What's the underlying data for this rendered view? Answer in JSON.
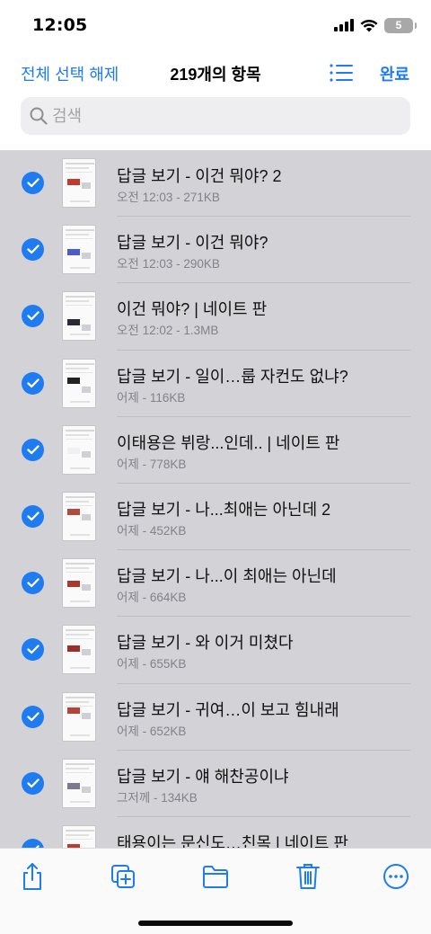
{
  "status": {
    "time": "12:05",
    "battery": "5"
  },
  "nav": {
    "deselect_all": "전체 선택 해제",
    "title": "219개의 항목",
    "done": "완료"
  },
  "search": {
    "placeholder": "검색"
  },
  "items": [
    {
      "title": "답글 보기 - 이건 뭐야? 2",
      "subtitle": "오전 12:03 - 271KB",
      "selected": true,
      "thumb_accent": "#c0392b"
    },
    {
      "title": "답글 보기 - 이건 뭐야?",
      "subtitle": "오전 12:03 - 290KB",
      "selected": true,
      "thumb_accent": "#4a5bd0"
    },
    {
      "title": "이건 뭐야? | 네이트 판",
      "subtitle": "오전 12:02 - 1.3MB",
      "selected": true,
      "thumb_accent": "#2a2a35"
    },
    {
      "title": "답글 보기 - 일이…룹 자컨도 없냐?",
      "subtitle": "어제 - 116KB",
      "selected": true,
      "thumb_accent": "#222222"
    },
    {
      "title": "이태용은 뷔랑...인데.. | 네이트 판",
      "subtitle": "어제 - 778KB",
      "selected": true,
      "thumb_accent": "#f0f0f0"
    },
    {
      "title": "답글 보기 - 나...최애는 아닌데 2",
      "subtitle": "어제 - 452KB",
      "selected": true,
      "thumb_accent": "#b04a3a"
    },
    {
      "title": "답글 보기 - 나...이 최애는 아닌데",
      "subtitle": "어제 - 664KB",
      "selected": true,
      "thumb_accent": "#a83a30"
    },
    {
      "title": "답글 보기 - 와 이거 미쳤다",
      "subtitle": "어제 - 655KB",
      "selected": true,
      "thumb_accent": "#9c2f2a"
    },
    {
      "title": "답글 보기 - 귀여…이 보고 힘내래",
      "subtitle": "어제 - 652KB",
      "selected": true,
      "thumb_accent": "#b5433a"
    },
    {
      "title": "답글 보기 - 얘 해찬공이냐",
      "subtitle": "그저께 - 134KB",
      "selected": true,
      "thumb_accent": "#7a7a90"
    },
    {
      "title": "태용이는 문신도…친목 | 네이트 판",
      "subtitle": "",
      "selected": true,
      "thumb_accent": "#c0392b"
    }
  ],
  "toolbar": {
    "share_icon": "share-icon",
    "duplicate_icon": "duplicate-icon",
    "folder_icon": "folder-icon",
    "trash_icon": "trash-icon",
    "more_icon": "more-icon"
  },
  "colors": {
    "accent": "#1f7cf0",
    "list_bg": "#d2d2d7"
  }
}
